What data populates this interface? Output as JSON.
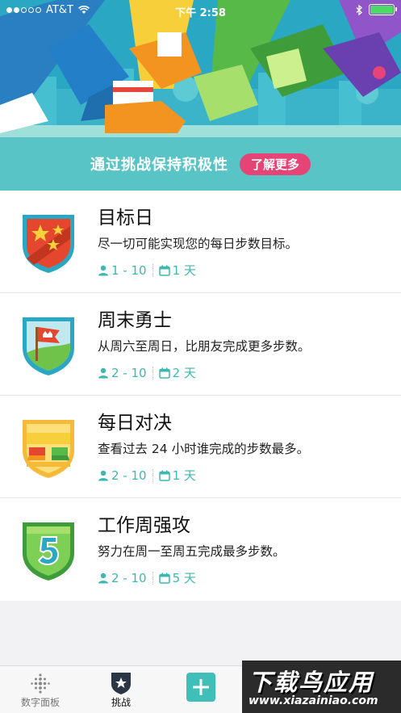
{
  "status_bar": {
    "carrier": "AT&T",
    "time": "下午 2:58"
  },
  "hero": {
    "headline": "通过挑战保持积极性",
    "learn_more": "了解更多"
  },
  "challenges": [
    {
      "title": "目标日",
      "description": "尽一切可能实现您的每日步数目标。",
      "players": "1 - 10",
      "duration": "1 天",
      "badge": "stars-badge"
    },
    {
      "title": "周末勇士",
      "description": "从周六至周日，比朋友完成更多步数。",
      "players": "2 - 10",
      "duration": "2 天",
      "badge": "flag-badge"
    },
    {
      "title": "每日对决",
      "description": "查看过去 24 小时谁完成的步数最多。",
      "players": "2 - 10",
      "duration": "1 天",
      "badge": "duel-badge"
    },
    {
      "title": "工作周强攻",
      "description": "努力在周一至周五完成最多步数。",
      "players": "2 - 10",
      "duration": "5 天",
      "badge": "five-badge"
    }
  ],
  "tabs": {
    "dashboard": "数字面板",
    "challenges": "挑战"
  },
  "watermark": {
    "title": "下载鸟应用",
    "url": "www.xiazainiao.com"
  },
  "colors": {
    "accent": "#3fbfb7",
    "band": "#58c4c6",
    "learn_more": "#e64476"
  }
}
